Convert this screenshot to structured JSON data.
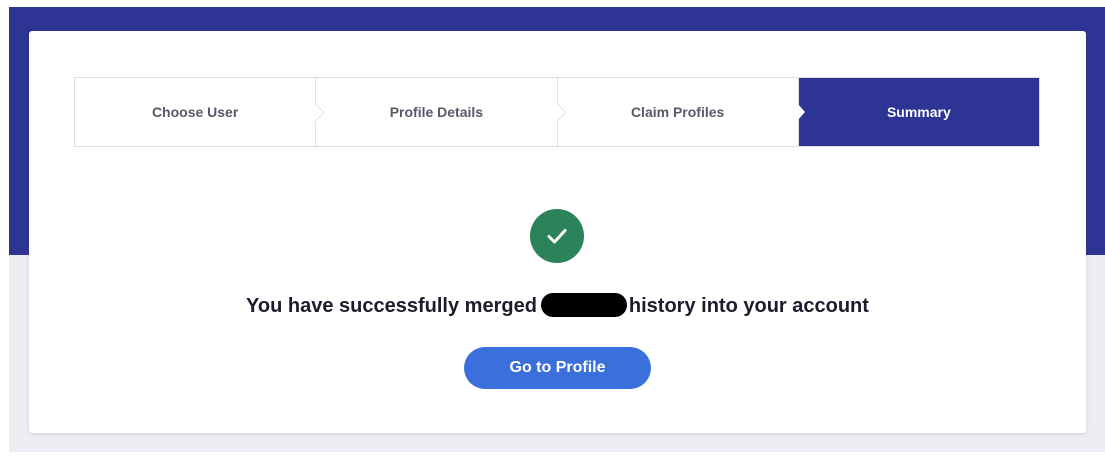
{
  "stepper": {
    "steps": [
      {
        "label": "Choose User"
      },
      {
        "label": "Profile Details"
      },
      {
        "label": "Claim Profiles"
      },
      {
        "label": "Summary"
      }
    ],
    "active_index": 3
  },
  "confirmation": {
    "message_before": "You have successfully merged",
    "message_after": "history into your account",
    "cta_label": "Go to Profile"
  },
  "icons": {
    "success": "checkmark-icon"
  },
  "colors": {
    "brand_navy": "#2e3494",
    "success_green": "#2b8459",
    "cta_blue": "#3a6fdc"
  }
}
